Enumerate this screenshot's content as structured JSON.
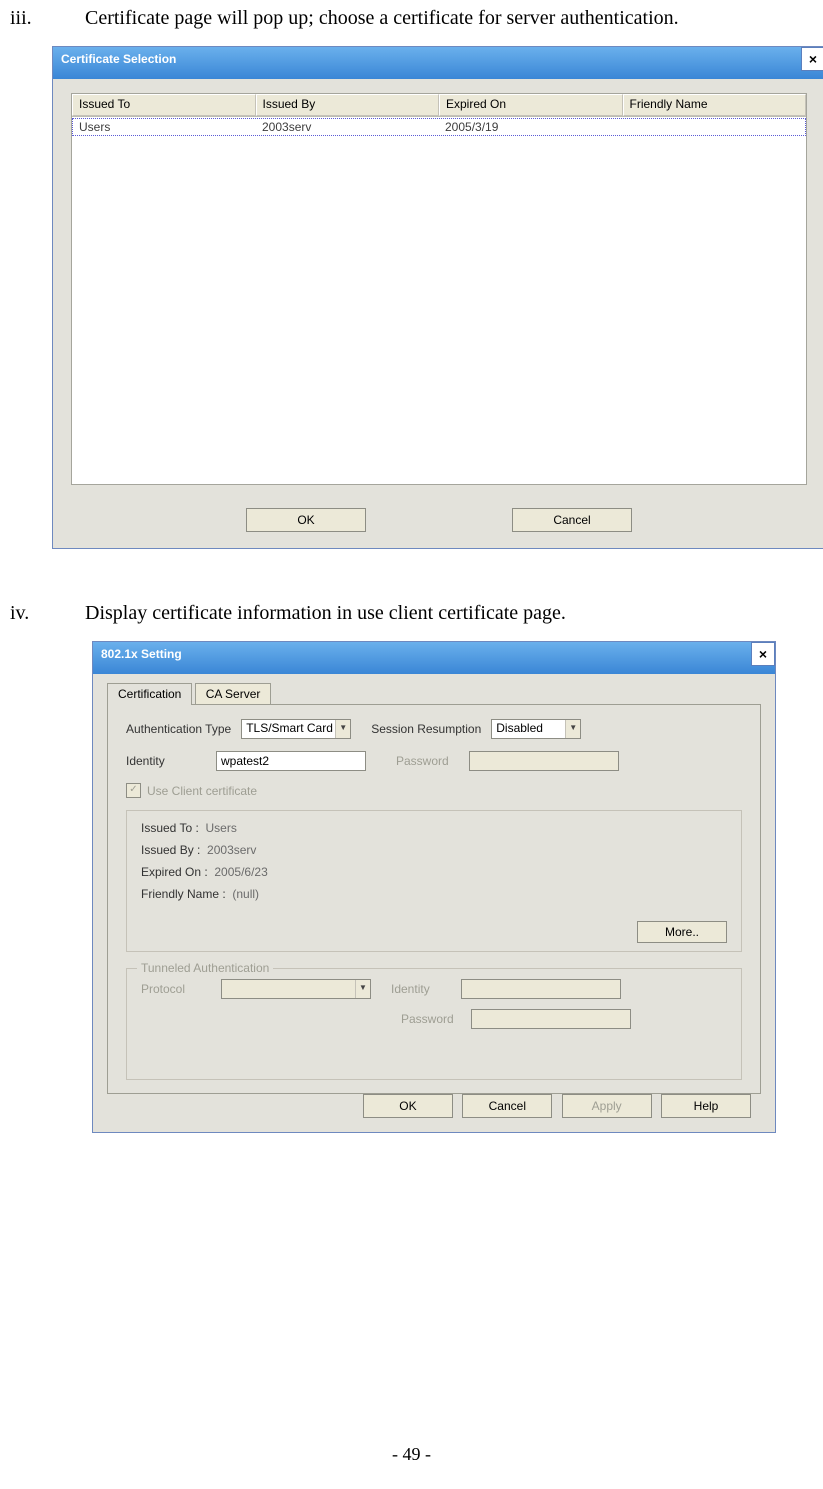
{
  "step3": {
    "num": "iii.",
    "text": "Certificate page will pop up; choose a certificate for server authentication."
  },
  "step4": {
    "num": "iv.",
    "text": "Display certificate information in use client certificate page."
  },
  "dlg1": {
    "title": "Certificate Selection",
    "close": "×",
    "headers": [
      "Issued To",
      "Issued By",
      "Expired On",
      "Friendly Name"
    ],
    "row": [
      "Users",
      "2003serv",
      "2005/3/19",
      ""
    ],
    "ok": "OK",
    "cancel": "Cancel"
  },
  "dlg2": {
    "title": "802.1x Setting",
    "close": "×",
    "tab1": "Certification",
    "tab2": "CA Server",
    "authType_lbl": "Authentication Type",
    "authType_val": "TLS/Smart Card",
    "session_lbl": "Session Resumption",
    "session_val": "Disabled",
    "identity_lbl": "Identity",
    "identity_val": "wpatest2",
    "password_lbl": "Password",
    "useClient": "Use Client certificate",
    "issuedTo_lbl": "Issued To :",
    "issuedTo_val": "Users",
    "issuedBy_lbl": "Issued By :",
    "issuedBy_val": "2003serv",
    "expiredOn_lbl": "Expired On :",
    "expiredOn_val": "2005/6/23",
    "friendly_lbl": "Friendly Name :",
    "friendly_val": "(null)",
    "more": "More..",
    "tunnel_legend": "Tunneled Authentication",
    "tunnel_protocol": "Protocol",
    "tunnel_identity": "Identity",
    "tunnel_password": "Password",
    "ok": "OK",
    "cancel": "Cancel",
    "apply": "Apply",
    "help": "Help"
  },
  "footer": "- 49 -"
}
